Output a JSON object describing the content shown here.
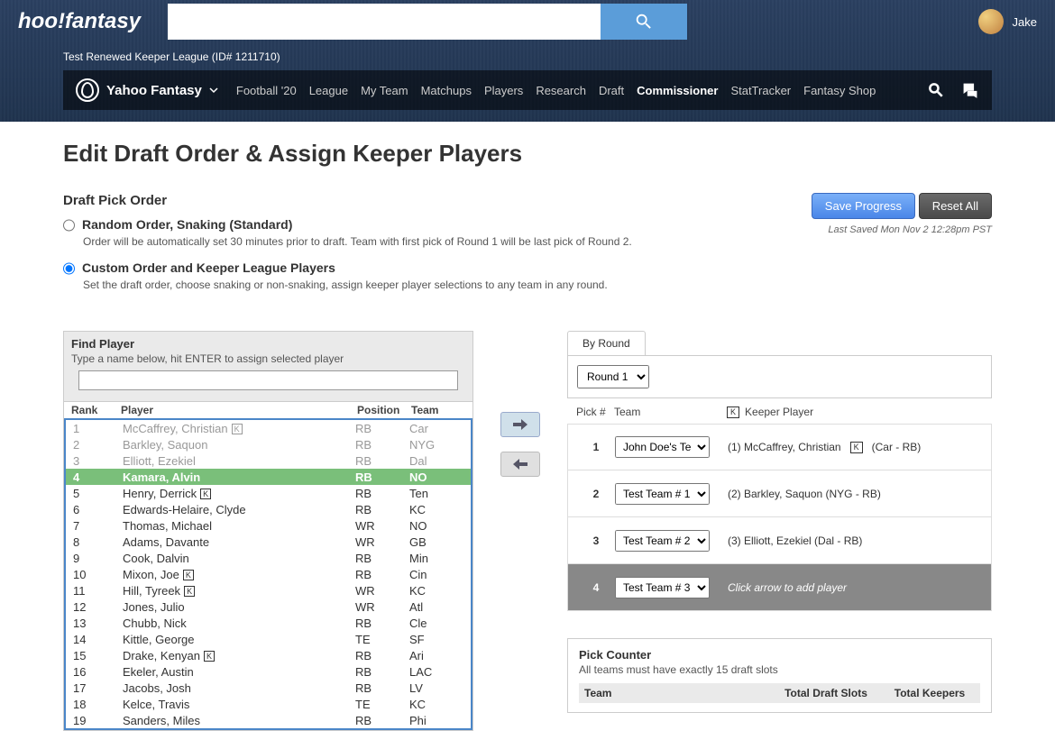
{
  "brand": "hoo!fantasy",
  "user": {
    "name": "Jake"
  },
  "league_info": "Test Renewed Keeper League (ID# 1211710)",
  "nav": {
    "brand": "Yahoo Fantasy",
    "items": [
      "Football '20",
      "League",
      "My Team",
      "Matchups",
      "Players",
      "Research",
      "Draft",
      "Commissioner",
      "StatTracker",
      "Fantasy Shop"
    ],
    "active_index": 7
  },
  "page_title": "Edit Draft Order & Assign Keeper Players",
  "draft_order": {
    "heading": "Draft Pick Order",
    "options": [
      {
        "label": "Random Order, Snaking (Standard)",
        "desc": "Order will be automatically set 30 minutes prior to draft. Team with first pick of Round 1 will be last pick of Round 2.",
        "checked": false
      },
      {
        "label": "Custom Order and Keeper League Players",
        "desc": "Set the draft order, choose snaking or non-snaking, assign keeper player selections to any team in any round.",
        "checked": true
      }
    ]
  },
  "buttons": {
    "save": "Save Progress",
    "reset": "Reset All"
  },
  "last_saved": "Last Saved Mon Nov 2 12:28pm PST",
  "find_player": {
    "title": "Find Player",
    "subtitle": "Type a name below, hit ENTER to assign selected player",
    "input_value": "",
    "headers": {
      "rank": "Rank",
      "player": "Player",
      "position": "Position",
      "team": "Team"
    }
  },
  "players": [
    {
      "rank": 1,
      "name": "McCaffrey, Christian",
      "keeper": true,
      "pos": "RB",
      "team": "Car",
      "assigned": true
    },
    {
      "rank": 2,
      "name": "Barkley, Saquon",
      "keeper": false,
      "pos": "RB",
      "team": "NYG",
      "assigned": true
    },
    {
      "rank": 3,
      "name": "Elliott, Ezekiel",
      "keeper": false,
      "pos": "RB",
      "team": "Dal",
      "assigned": true
    },
    {
      "rank": 4,
      "name": "Kamara, Alvin",
      "keeper": false,
      "pos": "RB",
      "team": "NO",
      "assigned": false,
      "selected": true
    },
    {
      "rank": 5,
      "name": "Henry, Derrick",
      "keeper": true,
      "pos": "RB",
      "team": "Ten",
      "assigned": false
    },
    {
      "rank": 6,
      "name": "Edwards-Helaire, Clyde",
      "keeper": false,
      "pos": "RB",
      "team": "KC",
      "assigned": false
    },
    {
      "rank": 7,
      "name": "Thomas, Michael",
      "keeper": false,
      "pos": "WR",
      "team": "NO",
      "assigned": false
    },
    {
      "rank": 8,
      "name": "Adams, Davante",
      "keeper": false,
      "pos": "WR",
      "team": "GB",
      "assigned": false
    },
    {
      "rank": 9,
      "name": "Cook, Dalvin",
      "keeper": false,
      "pos": "RB",
      "team": "Min",
      "assigned": false
    },
    {
      "rank": 10,
      "name": "Mixon, Joe",
      "keeper": true,
      "pos": "RB",
      "team": "Cin",
      "assigned": false
    },
    {
      "rank": 11,
      "name": "Hill, Tyreek",
      "keeper": true,
      "pos": "WR",
      "team": "KC",
      "assigned": false
    },
    {
      "rank": 12,
      "name": "Jones, Julio",
      "keeper": false,
      "pos": "WR",
      "team": "Atl",
      "assigned": false
    },
    {
      "rank": 13,
      "name": "Chubb, Nick",
      "keeper": false,
      "pos": "RB",
      "team": "Cle",
      "assigned": false
    },
    {
      "rank": 14,
      "name": "Kittle, George",
      "keeper": false,
      "pos": "TE",
      "team": "SF",
      "assigned": false
    },
    {
      "rank": 15,
      "name": "Drake, Kenyan",
      "keeper": true,
      "pos": "RB",
      "team": "Ari",
      "assigned": false
    },
    {
      "rank": 16,
      "name": "Ekeler, Austin",
      "keeper": false,
      "pos": "RB",
      "team": "LAC",
      "assigned": false
    },
    {
      "rank": 17,
      "name": "Jacobs, Josh",
      "keeper": false,
      "pos": "RB",
      "team": "LV",
      "assigned": false
    },
    {
      "rank": 18,
      "name": "Kelce, Travis",
      "keeper": false,
      "pos": "TE",
      "team": "KC",
      "assigned": false
    },
    {
      "rank": 19,
      "name": "Sanders, Miles",
      "keeper": false,
      "pos": "RB",
      "team": "Phi",
      "assigned": false
    }
  ],
  "by_round": {
    "tab_label": "By Round",
    "round_selected": "Round 1",
    "headers": {
      "pick": "Pick #",
      "team": "Team",
      "keeper": "Keeper Player"
    }
  },
  "picks": [
    {
      "num": 1,
      "team": "John Doe's Team",
      "keeper": "(1) McCaffrey, Christian",
      "keeper_badge": true,
      "suffix": "(Car - RB)"
    },
    {
      "num": 2,
      "team": "Test Team # 1",
      "keeper": "(2) Barkley, Saquon (NYG - RB)",
      "keeper_badge": false,
      "suffix": ""
    },
    {
      "num": 3,
      "team": "Test Team # 2",
      "keeper": "(3) Elliott, Ezekiel (Dal - RB)",
      "keeper_badge": false,
      "suffix": ""
    },
    {
      "num": 4,
      "team": "Test Team # 3",
      "keeper": "Click arrow to add player",
      "keeper_badge": false,
      "suffix": "",
      "active": true
    }
  ],
  "counter": {
    "title": "Pick Counter",
    "subtitle": "All teams must have exactly 15 draft slots",
    "headers": {
      "team": "Team",
      "slots": "Total Draft Slots",
      "keepers": "Total Keepers"
    }
  },
  "keeper_badge_text": "K"
}
